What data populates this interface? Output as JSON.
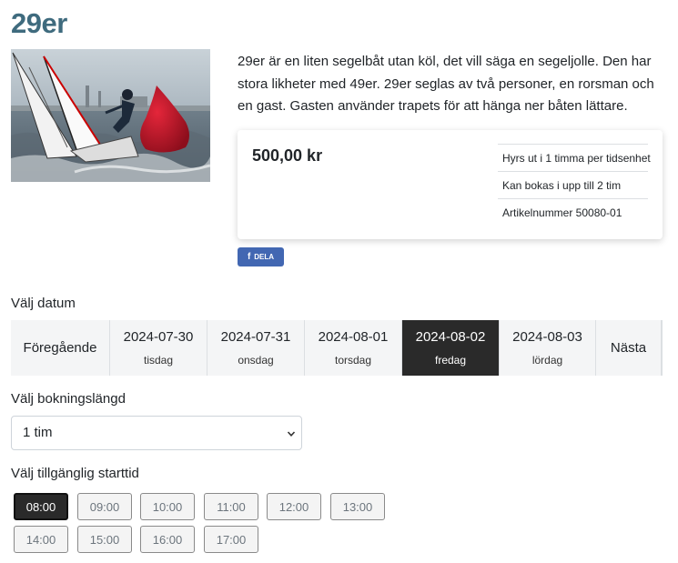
{
  "product": {
    "title": "29er",
    "image_alt": "Segelbåt 29er med boj",
    "description": "29er är en liten segelbåt utan köl, det vill säga en segeljolle. Den har stora likheter med 49er. 29er seglas av två personer, en rorsman och en gast. Gasten använder trapets för att hänga ner båten lättare.",
    "price": "500,00 kr",
    "info": [
      "Hyrs ut i 1 timma per tidsenhet",
      "Kan bokas i upp till 2 tim",
      "Artikelnummer 50080-01"
    ],
    "share_label": "DELA",
    "share_icon": "facebook-icon"
  },
  "date_section": {
    "label": "Välj datum",
    "prev_label": "Föregående",
    "next_label": "Nästa",
    "dates": [
      {
        "date": "2024-07-30",
        "weekday": "tisdag",
        "selected": false
      },
      {
        "date": "2024-07-31",
        "weekday": "onsdag",
        "selected": false
      },
      {
        "date": "2024-08-01",
        "weekday": "torsdag",
        "selected": false
      },
      {
        "date": "2024-08-02",
        "weekday": "fredag",
        "selected": true
      },
      {
        "date": "2024-08-03",
        "weekday": "lördag",
        "selected": false
      }
    ]
  },
  "duration": {
    "label": "Välj bokningslängd",
    "selected": "1 tim"
  },
  "times": {
    "label": "Välj tillgänglig starttid",
    "slots": [
      "08:00",
      "09:00",
      "10:00",
      "11:00",
      "12:00",
      "13:00",
      "14:00",
      "15:00",
      "16:00",
      "17:00"
    ],
    "selected": "08:00"
  }
}
